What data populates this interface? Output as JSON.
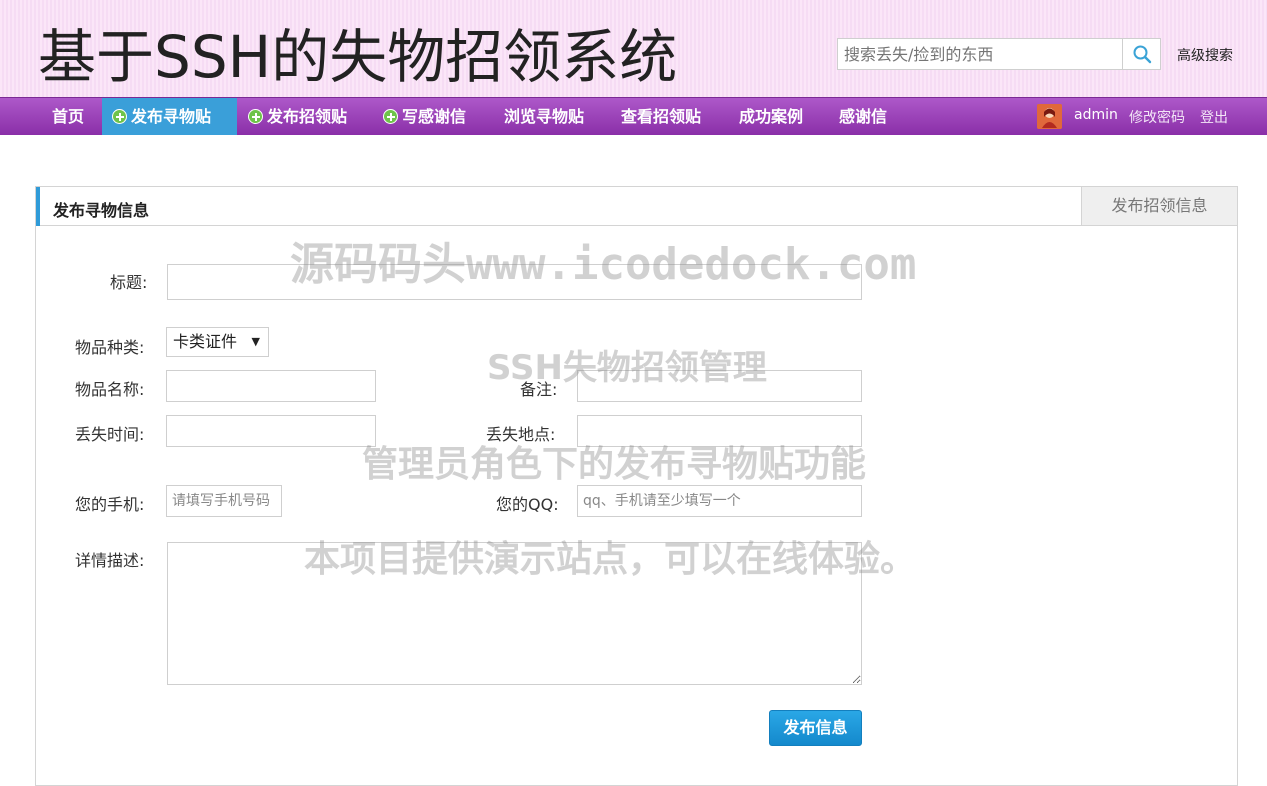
{
  "header": {
    "title": "基于SSH的失物招领系统",
    "search_placeholder": "搜索丢失/捡到的东西",
    "advanced_search": "高级搜索"
  },
  "nav": {
    "items": [
      {
        "label": "首页"
      },
      {
        "label": "发布寻物贴",
        "active": true,
        "icon": "plus-icon"
      },
      {
        "label": "发布招领贴",
        "icon": "plus-icon"
      },
      {
        "label": "写感谢信",
        "icon": "plus-icon"
      },
      {
        "label": "浏览寻物贴"
      },
      {
        "label": "查看招领贴"
      },
      {
        "label": "成功案例"
      },
      {
        "label": "感谢信"
      }
    ],
    "user": {
      "name": "admin",
      "change_password": "修改密码",
      "logout": "登出"
    }
  },
  "panel": {
    "title": "发布寻物信息",
    "tab": "发布招领信息"
  },
  "form": {
    "title_label": "标题:",
    "category_label": "物品种类:",
    "category_value": "卡类证件",
    "name_label": "物品名称:",
    "note_label": "备注:",
    "time_label": "丢失时间:",
    "place_label": "丢失地点:",
    "phone_label": "您的手机:",
    "phone_placeholder": "请填写手机号码",
    "qq_label": "您的QQ:",
    "qq_placeholder": "qq、手机请至少填写一个",
    "detail_label": "详情描述:",
    "submit": "发布信息"
  },
  "watermark": {
    "line1": "源码码头www.icodedock.com",
    "line2": "SSH失物招领管理",
    "line3": "管理员角色下的发布寻物贴功能",
    "line4": "本项目提供演示站点，可以在线体验。"
  },
  "colors": {
    "nav_bg": "#9b42b8",
    "nav_active": "#3a9fd9",
    "accent": "#2f9bd8",
    "submit": "#1e98db"
  }
}
